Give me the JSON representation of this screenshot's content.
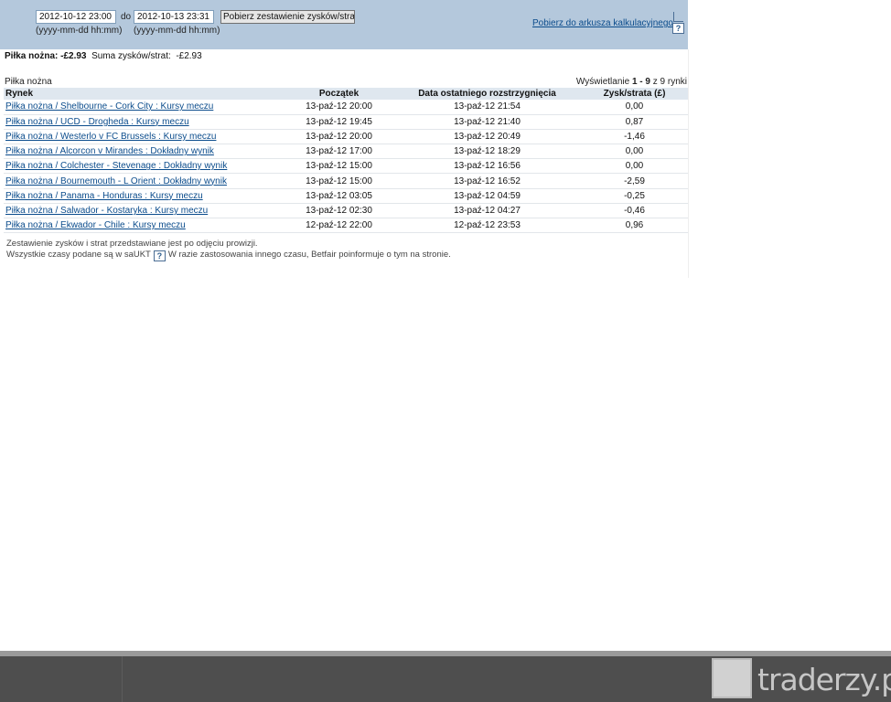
{
  "filters": {
    "from_value": "2012-10-12 23:00",
    "to_label": "do",
    "to_value": "2012-10-13 23:31",
    "from_hint": "(yyyy-mm-dd hh:mm)",
    "to_hint": "(yyyy-mm-dd hh:mm)",
    "fetch_button": "Pobierz zestawienie zysków/strat",
    "spreadsheet_link": "Pobierz do arkusza kalkulacyjnego",
    "help": "?"
  },
  "summary": {
    "sport_label": "Piłka nożna:",
    "sport_value": "-£2.93",
    "total_label": "Suma zysków/strat:",
    "total_value": "-£2.93"
  },
  "section": {
    "title": "Piłka nożna",
    "paging_prefix": "Wyświetlanie",
    "paging_range": "1 - 9",
    "paging_suffix": "z 9 rynki"
  },
  "table": {
    "headers": [
      "Rynek",
      "Początek",
      "Data ostatniego rozstrzygnięcia",
      "Zysk/strata (£)"
    ],
    "rows": [
      {
        "market": "Piłka nożna / Shelbourne - Cork City : Kursy meczu",
        "start": "13-paź-12 20:00",
        "settled": "13-paź-12 21:54",
        "pl": "0,00"
      },
      {
        "market": "Piłka nożna / UCD - Drogheda : Kursy meczu",
        "start": "13-paź-12 19:45",
        "settled": "13-paź-12 21:40",
        "pl": "0,87"
      },
      {
        "market": "Piłka nożna / Westerlo v FC Brussels : Kursy meczu",
        "start": "13-paź-12 20:00",
        "settled": "13-paź-12 20:49",
        "pl": "-1,46"
      },
      {
        "market": "Piłka nożna / Alcorcon v Mirandes : Dokładny wynik",
        "start": "13-paź-12 17:00",
        "settled": "13-paź-12 18:29",
        "pl": "0,00"
      },
      {
        "market": "Piłka nożna / Colchester - Stevenage : Dokładny wynik",
        "start": "13-paź-12 15:00",
        "settled": "13-paź-12 16:56",
        "pl": "0,00"
      },
      {
        "market": "Piłka nożna / Bournemouth - L Orient : Dokładny wynik",
        "start": "13-paź-12 15:00",
        "settled": "13-paź-12 16:52",
        "pl": "-2,59"
      },
      {
        "market": "Piłka nożna / Panama - Honduras : Kursy meczu",
        "start": "13-paź-12 03:05",
        "settled": "13-paź-12 04:59",
        "pl": "-0,25"
      },
      {
        "market": "Piłka nożna / Salwador - Kostaryka : Kursy meczu",
        "start": "13-paź-12 02:30",
        "settled": "13-paź-12 04:27",
        "pl": "-0,46"
      },
      {
        "market": "Piłka nożna / Ekwador - Chile : Kursy meczu",
        "start": "12-paź-12 22:00",
        "settled": "12-paź-12 23:53",
        "pl": "0,96"
      }
    ]
  },
  "notes": {
    "line1": "Zestawienie zysków i strat przedstawiane jest po odjęciu prowizji.",
    "line2_prefix": "Wszystkie czasy podane są w saUKT",
    "line2_suffix": "W razie zastosowania innego czasu, Betfair poinformuje o tym na stronie."
  },
  "watermark": {
    "text": "traderzy.pl"
  }
}
